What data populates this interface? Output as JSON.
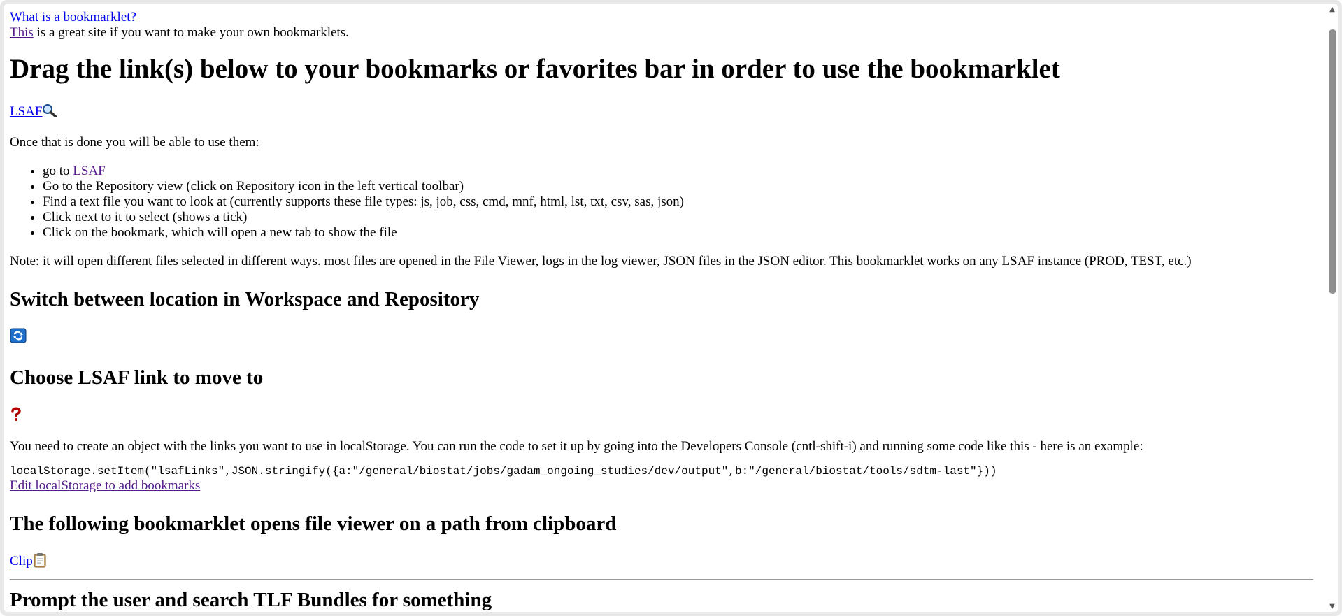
{
  "top": {
    "what_link": "What is a bookmarklet?",
    "this_link": "This",
    "this_rest": " is a great site if you want to make your own bookmarklets."
  },
  "main_heading": "Drag the link(s) below to your bookmarks or favorites bar in order to use the bookmarklet",
  "lsaf_bookmarklet": {
    "label": "LSAF",
    "icon": "magnifier-icon"
  },
  "usage_intro": "Once that is done you will be able to use them:",
  "steps": [
    {
      "prefix": "go to ",
      "link": "LSAF"
    },
    {
      "text": "Go to the Repository view (click on Repository icon in the left vertical toolbar)"
    },
    {
      "text": "Find a text file you want to look at (currently supports these file types: js, job, css, cmd, mnf, html, lst, txt, csv, sas, json)"
    },
    {
      "text": "Click next to it to select (shows a tick)"
    },
    {
      "text": "Click on the bookmark, which will open a new tab to show the file"
    }
  ],
  "note": "Note: it will open different files selected in different ways. most files are opened in the File Viewer, logs in the log viewer, JSON files in the JSON editor. This bookmarklet works on any LSAF instance (PROD, TEST, etc.)",
  "switch_heading": "Switch between location in Workspace and Repository",
  "switch_icon": "switch-arrows-icon",
  "choose_heading": "Choose LSAF link to move to",
  "choose_icon": "question-mark-icon",
  "choose_desc": "You need to create an object with the links you want to use in localStorage. You can run the code to set it up by going into the Developers Console (cntl-shift-i) and running some code like this - here is an example:",
  "code_example": "localStorage.setItem(\"lsafLinks\",JSON.stringify({a:\"/general/biostat/jobs/gadam_ongoing_studies/dev/output\",b:\"/general/biostat/tools/sdtm-last\"}))",
  "edit_link": "Edit localStorage to add bookmarks",
  "clip_heading": "The following bookmarklet opens file viewer on a path from clipboard",
  "clip_bookmarklet": {
    "label": "Clip",
    "icon": "clipboard-icon"
  },
  "tlf_heading": "Prompt the user and search TLF Bundles for something",
  "colors": {
    "link": "#0000ee",
    "visited": "#551a8b",
    "scroll_thumb": "#8e8e8e"
  }
}
